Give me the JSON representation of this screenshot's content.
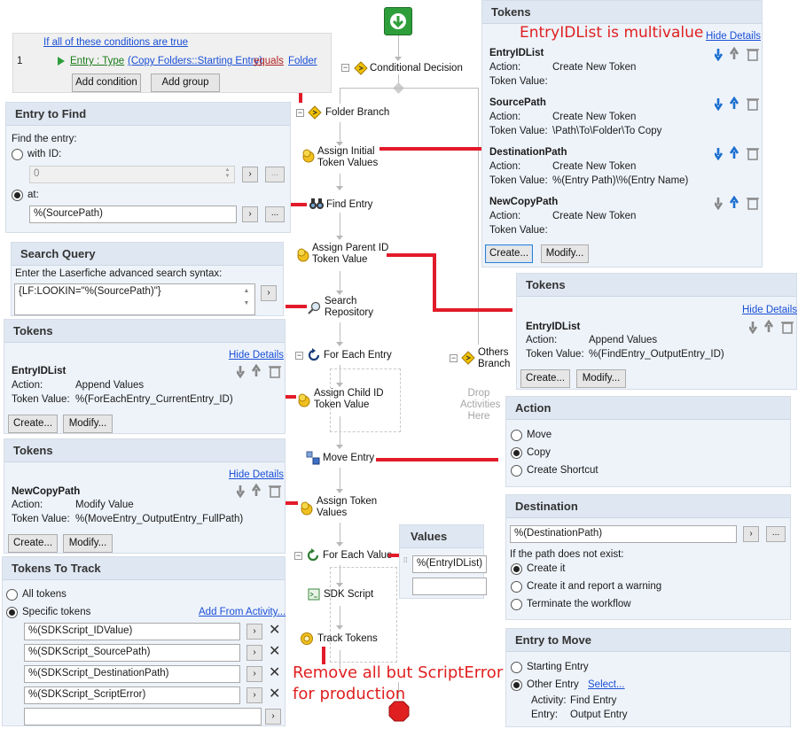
{
  "conditions": {
    "header": "If all of these conditions are true",
    "row_number": "1",
    "field": "Entry : Type",
    "source": "(Copy Folders::Starting Entry)",
    "operator": "equals",
    "value": "Folder",
    "add_condition": "Add condition",
    "add_group": "Add group"
  },
  "entry_to_find": {
    "title": "Entry to Find",
    "find_label": "Find the entry:",
    "with_id": "with ID:",
    "id_value": "0",
    "at": "at:",
    "at_value": "%(SourcePath)",
    "ellipsis": "..."
  },
  "search_query": {
    "title": "Search Query",
    "prompt": "Enter the Laserfiche advanced search syntax:",
    "value": "{LF:LOOKIN=\"%(SourcePath)\"}"
  },
  "tokens_left_1": {
    "title": "Tokens",
    "hide_details": "Hide Details",
    "name": "EntryIDList",
    "action_label": "Action:",
    "action": "Append Values",
    "value_label": "Token Value:",
    "value": "%(ForEachEntry_CurrentEntry_ID)",
    "create": "Create...",
    "modify": "Modify..."
  },
  "tokens_left_2": {
    "title": "Tokens",
    "hide_details": "Hide Details",
    "name": "NewCopyPath",
    "action_label": "Action:",
    "action": "Modify Value",
    "value_label": "Token Value:",
    "value": "%(MoveEntry_OutputEntry_FullPath)",
    "create": "Create...",
    "modify": "Modify..."
  },
  "tokens_to_track": {
    "title": "Tokens To Track",
    "all_tokens": "All tokens",
    "specific_tokens": "Specific tokens",
    "add_from_activity": "Add From Activity...",
    "items": [
      "%(SDKScript_IDValue)",
      "%(SDKScript_SourcePath)",
      "%(SDKScript_DestinationPath)",
      "%(SDKScript_ScriptError)",
      ""
    ]
  },
  "workflow": {
    "conditional_decision": "Conditional Decision",
    "folder_branch": "Folder Branch",
    "assign_initial_1": "Assign Initial",
    "assign_initial_2": "Token Values",
    "find_entry": "Find Entry",
    "assign_parent_1": "Assign Parent ID",
    "assign_parent_2": "Token Value",
    "search_repo_1": "Search",
    "search_repo_2": "Repository",
    "for_each_entry": "For Each Entry",
    "others_1": "Others",
    "others_2": "Branch",
    "drop_1": "Drop",
    "drop_2": "Activities",
    "drop_3": "Here",
    "assign_child_1": "Assign Child ID",
    "assign_child_2": "Token Value",
    "move_entry": "Move Entry",
    "assign_token_1": "Assign Token",
    "assign_token_2": "Values",
    "for_each_value": "For Each Value",
    "sdk_script": "SDK Script",
    "track_tokens": "Track Tokens"
  },
  "values_panel": {
    "title": "Values",
    "item": "%(EntryIDList)"
  },
  "tokens_top_right": {
    "title": "Tokens",
    "note": "EntryIDList is multivalue",
    "hide_details": "Hide Details",
    "action_label": "Action:",
    "value_label": "Token Value:",
    "items": [
      {
        "name": "EntryIDList",
        "action": "Create New Token",
        "value": ""
      },
      {
        "name": "SourcePath",
        "action": "Create New Token",
        "value": "\\Path\\To\\Folder\\To Copy"
      },
      {
        "name": "DestinationPath",
        "action": "Create New Token",
        "value": "%(Entry Path)\\%(Entry Name)"
      },
      {
        "name": "NewCopyPath",
        "action": "Create New Token",
        "value": ""
      }
    ],
    "create": "Create...",
    "modify": "Modify..."
  },
  "tokens_right_2": {
    "title": "Tokens",
    "hide_details": "Hide Details",
    "name": "EntryIDList",
    "action_label": "Action:",
    "action": "Append Values",
    "value_label": "Token Value:",
    "value": "%(FindEntry_OutputEntry_ID)",
    "create": "Create...",
    "modify": "Modify..."
  },
  "action_panel": {
    "title": "Action",
    "options": [
      "Move",
      "Copy",
      "Create Shortcut"
    ],
    "selected": "Copy"
  },
  "destination_panel": {
    "title": "Destination",
    "value": "%(DestinationPath)",
    "if_not_exist": "If the path does not exist:",
    "options": [
      "Create it",
      "Create it and report a warning",
      "Terminate the workflow"
    ]
  },
  "entry_to_move": {
    "title": "Entry to Move",
    "starting_entry": "Starting Entry",
    "other_entry": "Other Entry",
    "select": "Select...",
    "activity_label": "Activity:",
    "activity": "Find Entry",
    "entry_label": "Entry:",
    "entry": "Output Entry"
  },
  "annotation": {
    "line1": "Remove all but ScriptError",
    "line2": "for production"
  },
  "colors": {
    "panel_bg": "#eef3fa",
    "panel_head": "#dfe7f2",
    "accent_red": "#e21b2a",
    "link_blue": "#1a4fd6",
    "start_green": "#2e9e3a"
  }
}
